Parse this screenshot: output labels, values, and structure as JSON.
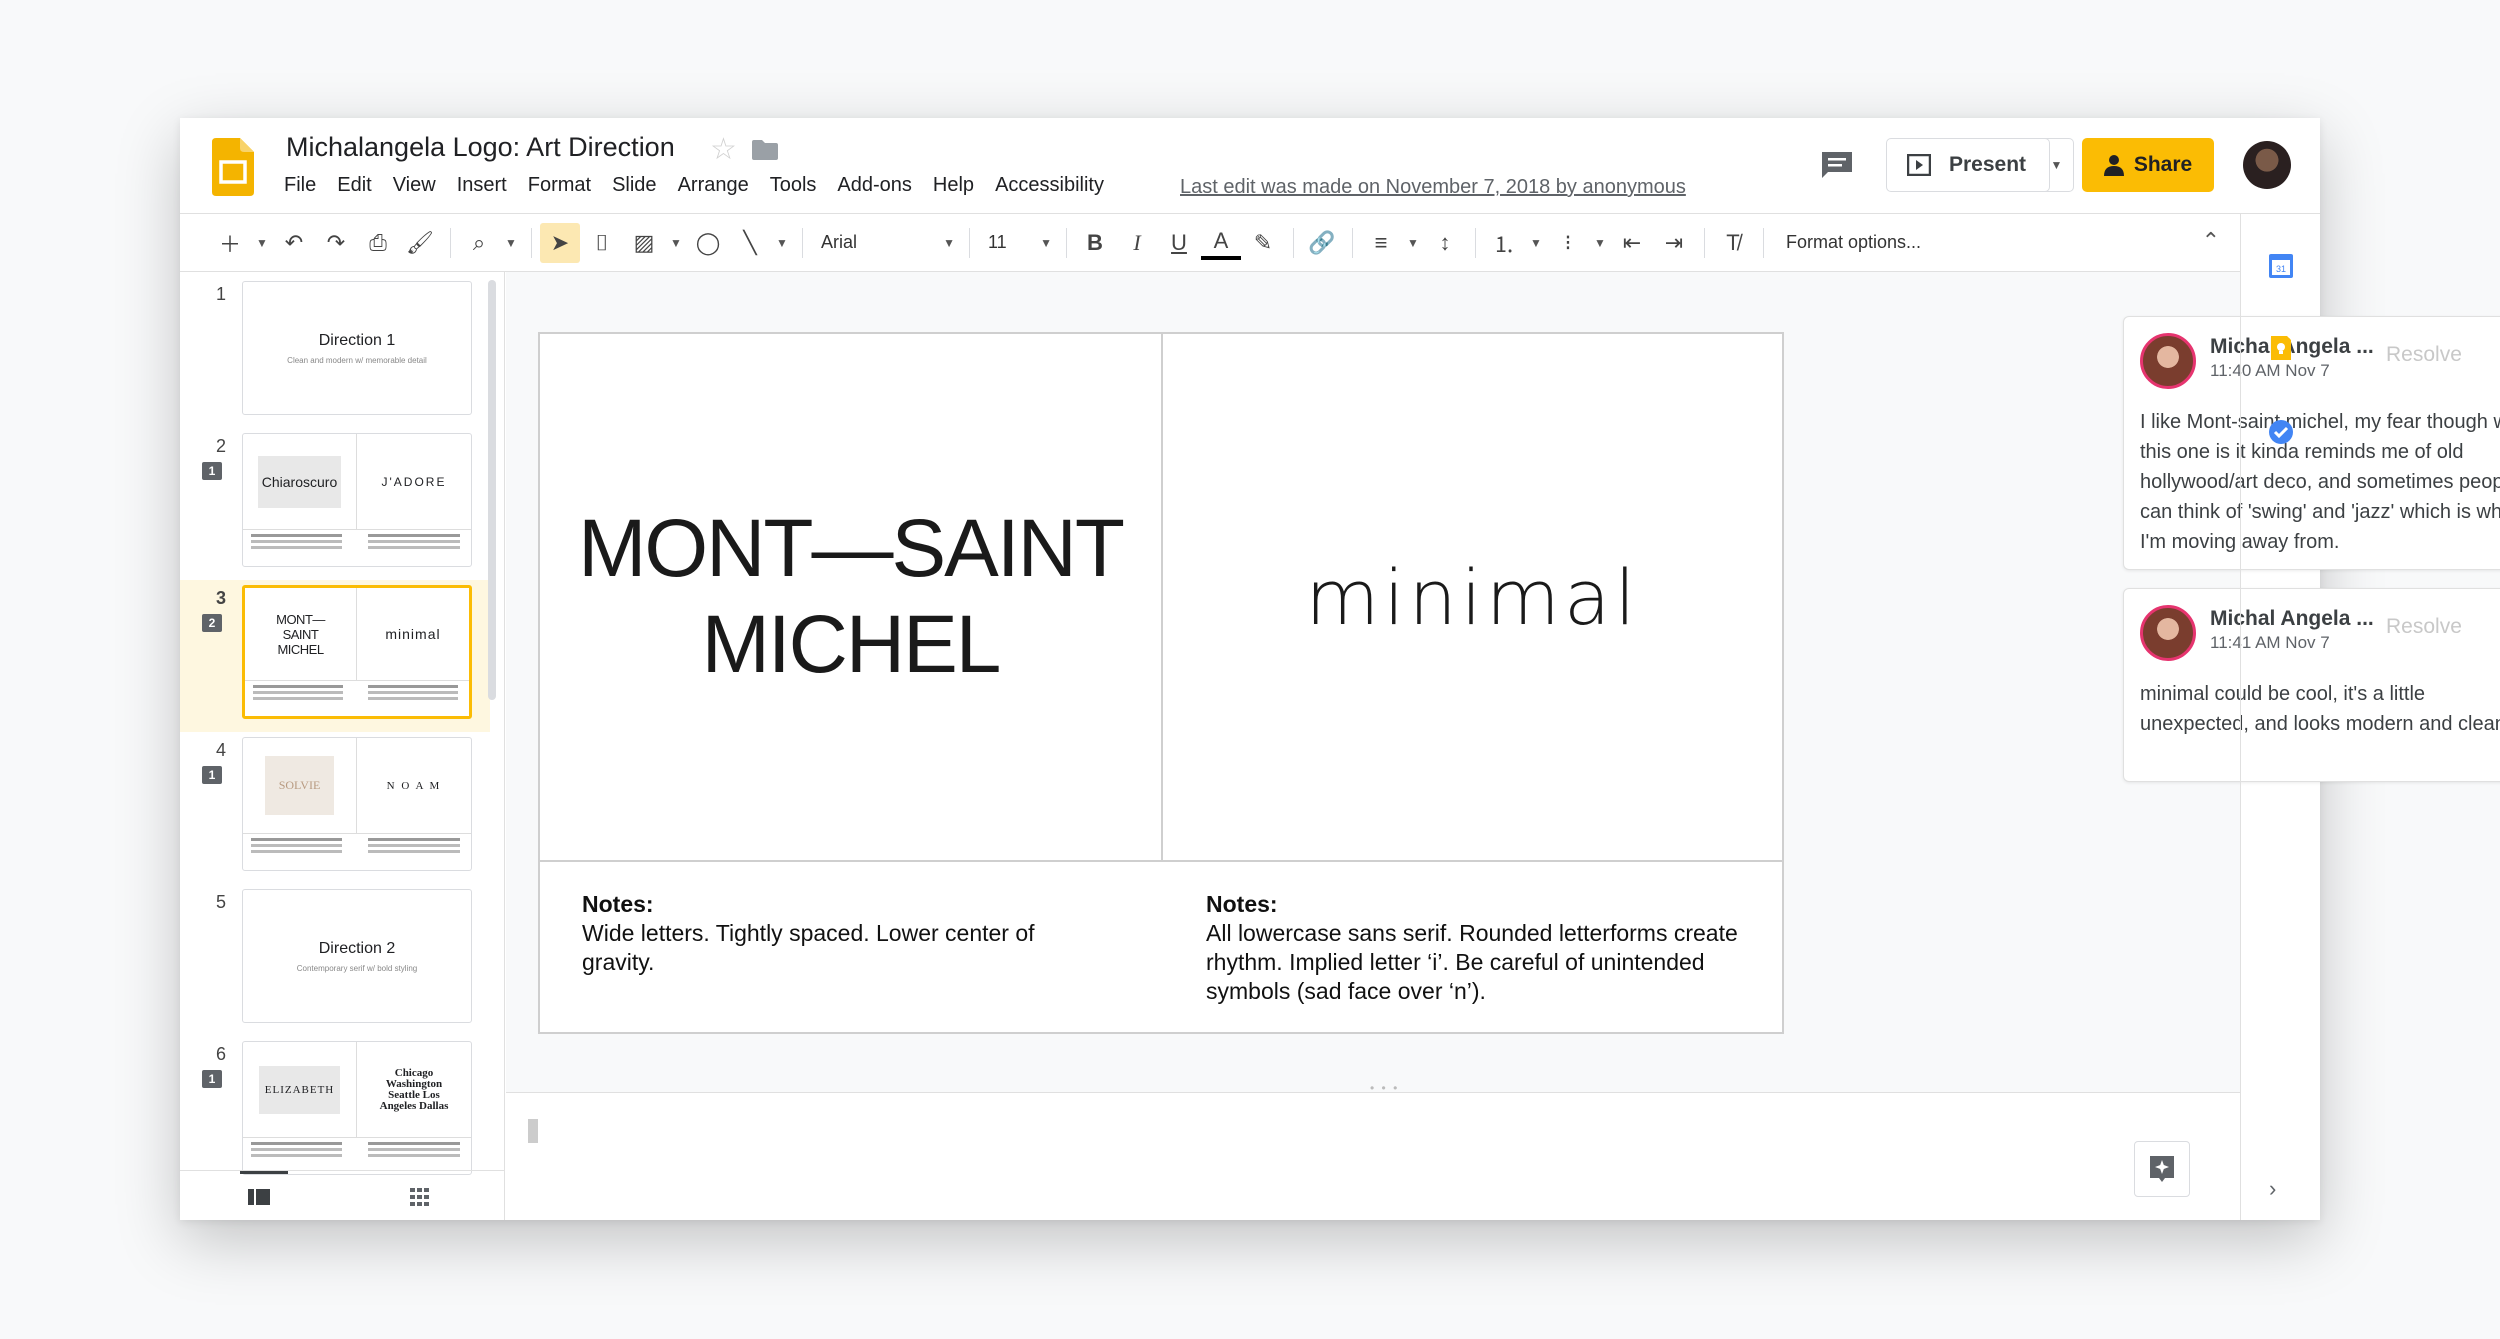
{
  "header": {
    "title": "Michalangela Logo: Art Direction",
    "menu": [
      "File",
      "Edit",
      "View",
      "Insert",
      "Format",
      "Slide",
      "Arrange",
      "Tools",
      "Add-ons",
      "Help",
      "Accessibility"
    ],
    "last_edit": "Last edit was made on November 7, 2018 by anonymous",
    "present_label": "Present",
    "share_label": "Share"
  },
  "toolbar": {
    "font": "Arial",
    "size": "11",
    "format_options": "Format options..."
  },
  "slides": [
    {
      "num": "1",
      "comments": "",
      "title": "Direction 1",
      "subtitle": "Clean and modern w/ memorable detail"
    },
    {
      "num": "2",
      "comments": "1",
      "left": "Chiaroscuro",
      "right": "J'ADORE"
    },
    {
      "num": "3",
      "comments": "2",
      "left": "MONT—SAINT MICHEL",
      "right": "minimal"
    },
    {
      "num": "4",
      "comments": "1",
      "left": "SOLVIE",
      "right": "N O A M"
    },
    {
      "num": "5",
      "comments": "",
      "title": "Direction 2",
      "subtitle": "Contemporary serif w/ bold styling"
    },
    {
      "num": "6",
      "comments": "1",
      "left": "ELIZABETH",
      "right": "Chicago Washington Seattle Los Angeles Dallas"
    }
  ],
  "current_slide": {
    "left_logo_line1": "MONT—SAINT",
    "left_logo_line2": "MICHEL",
    "right_logo": "minimal",
    "notes_heading": "Notes:",
    "left_notes": "Wide letters. Tightly spaced. Lower center of gravity.",
    "right_notes": "All lowercase sans serif. Rounded letterforms create rhythm. Implied letter ‘i’. Be careful of unintended symbols (sad face over ‘n’)."
  },
  "comments": [
    {
      "author": "Michal Angela ...",
      "time": "11:40 AM Nov 7",
      "resolve": "Resolve",
      "text": "I like Mont-saint michel, my fear though with this one is it kinda reminds me of old hollywood/art deco, and sometimes people can think of 'swing' and 'jazz' which is what I'm moving away from."
    },
    {
      "author": "Michal Angela ...",
      "time": "11:41 AM Nov 7",
      "resolve": "Resolve",
      "text": "minimal could be cool, it's a little unexpected, and looks modern and clean"
    }
  ],
  "colors": {
    "accent": "#fbbc04",
    "selected_bg": "#fef7e0",
    "comment_ring": "#e6346f"
  }
}
